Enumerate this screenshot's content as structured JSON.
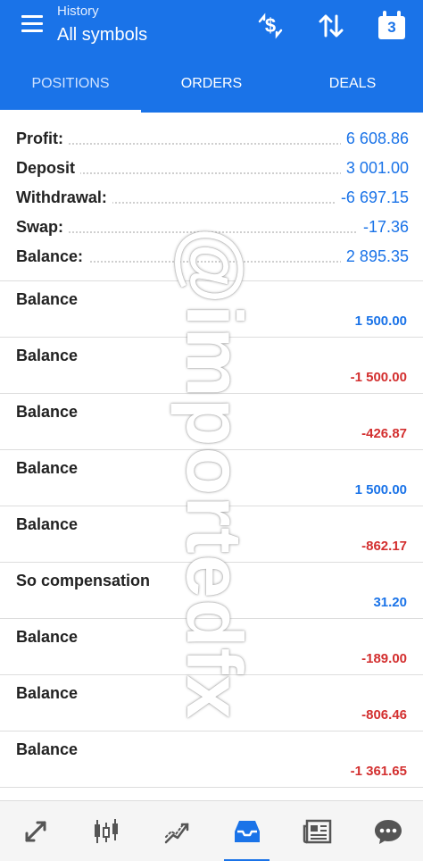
{
  "header": {
    "subtitle": "History",
    "title": "All symbols",
    "icons": [
      "menu-icon",
      "currency-sort-icon",
      "sort-arrows-icon",
      "calendar-icon"
    ],
    "calendar_day": "3",
    "accent_color": "#1a73e8"
  },
  "tabs": [
    {
      "label": "POSITIONS",
      "active": true
    },
    {
      "label": "ORDERS",
      "active": false
    },
    {
      "label": "DEALS",
      "active": false
    }
  ],
  "summary": [
    {
      "label": "Profit:",
      "value": "6 608.86"
    },
    {
      "label": "Deposit",
      "value": "3 001.00"
    },
    {
      "label": "Withdrawal:",
      "value": "-6 697.15"
    },
    {
      "label": "Swap:",
      "value": "-17.36"
    },
    {
      "label": "Balance:",
      "value": "2 895.35"
    }
  ],
  "deals": [
    {
      "name": "Balance",
      "amount": "1 500.00",
      "sign": "positive"
    },
    {
      "name": "Balance",
      "amount": "-1 500.00",
      "sign": "negative"
    },
    {
      "name": "Balance",
      "amount": "-426.87",
      "sign": "negative"
    },
    {
      "name": "Balance",
      "amount": "1 500.00",
      "sign": "positive"
    },
    {
      "name": "Balance",
      "amount": "-862.17",
      "sign": "negative"
    },
    {
      "name": "So compensation",
      "amount": "31.20",
      "sign": "positive"
    },
    {
      "name": "Balance",
      "amount": "-189.00",
      "sign": "negative"
    },
    {
      "name": "Balance",
      "amount": "-806.46",
      "sign": "negative"
    },
    {
      "name": "Balance",
      "amount": "-1 361.65",
      "sign": "negative"
    }
  ],
  "watermark": "@importedfx",
  "bottom_nav": [
    {
      "icon": "quotes-icon",
      "active": false
    },
    {
      "icon": "candlestick-chart-icon",
      "active": false
    },
    {
      "icon": "trade-icon",
      "active": false
    },
    {
      "icon": "history-inbox-icon",
      "active": true
    },
    {
      "icon": "news-icon",
      "active": false
    },
    {
      "icon": "chat-icon",
      "active": false
    }
  ],
  "colors": {
    "positive": "#1a73e8",
    "negative": "#d32f2f"
  }
}
